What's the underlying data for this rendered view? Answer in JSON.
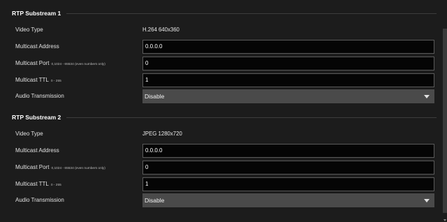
{
  "sections": [
    {
      "title": "RTP Substream 1",
      "video_type_label": "Video Type",
      "video_type_value": "H.264 640x360",
      "multicast_address_label": "Multicast Address",
      "multicast_address_value": "0.0.0.0",
      "multicast_port_label": "Multicast Port",
      "multicast_port_hint": "0,1024 - 65534 (even numbers only)",
      "multicast_port_value": "0",
      "multicast_ttl_label": "Multicast TTL",
      "multicast_ttl_hint": "0 - 255",
      "multicast_ttl_value": "1",
      "audio_transmission_label": "Audio Transmission",
      "audio_transmission_value": "Disable"
    },
    {
      "title": "RTP Substream 2",
      "video_type_label": "Video Type",
      "video_type_value": "JPEG 1280x720",
      "multicast_address_label": "Multicast Address",
      "multicast_address_value": "0.0.0.0",
      "multicast_port_label": "Multicast Port",
      "multicast_port_hint": "0,1024 - 65534 (even numbers only)",
      "multicast_port_value": "0",
      "multicast_ttl_label": "Multicast TTL",
      "multicast_ttl_hint": "0 - 255",
      "multicast_ttl_value": "1",
      "audio_transmission_label": "Audio Transmission",
      "audio_transmission_value": "Disable"
    }
  ],
  "icons": {
    "dropdown": "chevron-down-icon",
    "scroll": "scroll-down-arrow-icon"
  },
  "colors": {
    "background": "#1c1c1c",
    "field": "#050505",
    "select": "#4a4a4a"
  }
}
